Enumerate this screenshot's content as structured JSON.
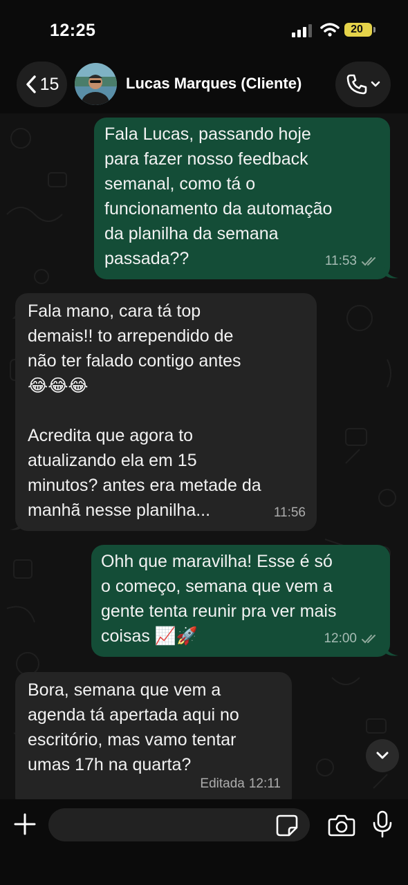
{
  "status_bar": {
    "time": "12:25",
    "battery_level": "20",
    "battery_color": "#e5d34a"
  },
  "header": {
    "back_count": "15",
    "contact_name": "Lucas Marques (Cliente)",
    "back_icon": "chevron-left-icon",
    "call_icon": "phone-icon"
  },
  "messages": [
    {
      "direction": "outgoing",
      "text": "Fala Lucas, passando hoje\npara fazer nosso feedback\nsemanal, como tá o\nfuncionamento da automação\nda planilha da semana\npassada??",
      "time": "11:53",
      "status": "read"
    },
    {
      "direction": "incoming",
      "text": "Fala mano, cara tá top\ndemais!! to arrependido de\nnão ter falado contigo antes\n😂😂😂\n\nAcredita que agora to\natualizando ela em 15\nminutos? antes era metade da\nmanhã nesse planilha...",
      "time": "11:56"
    },
    {
      "direction": "outgoing",
      "text": "Ohh que maravilha! Esse é só\no começo, semana que vem a\ngente tenta reunir pra ver mais\ncoisas 📈🚀",
      "time": "12:00",
      "status": "read"
    },
    {
      "direction": "incoming",
      "text": "Bora, semana que vem a\nagenda tá apertada aqui no\nescritório, mas vamo tentar\numas 17h na quarta?",
      "edited_label": "Editada",
      "time": "12:11"
    }
  ],
  "colors": {
    "outgoing_bubble": "#144d37",
    "incoming_bubble": "#242424",
    "background": "#0b0b0b"
  },
  "composer": {
    "placeholder": "",
    "icons": [
      "plus-icon",
      "sticker-icon",
      "camera-icon",
      "microphone-icon"
    ]
  }
}
